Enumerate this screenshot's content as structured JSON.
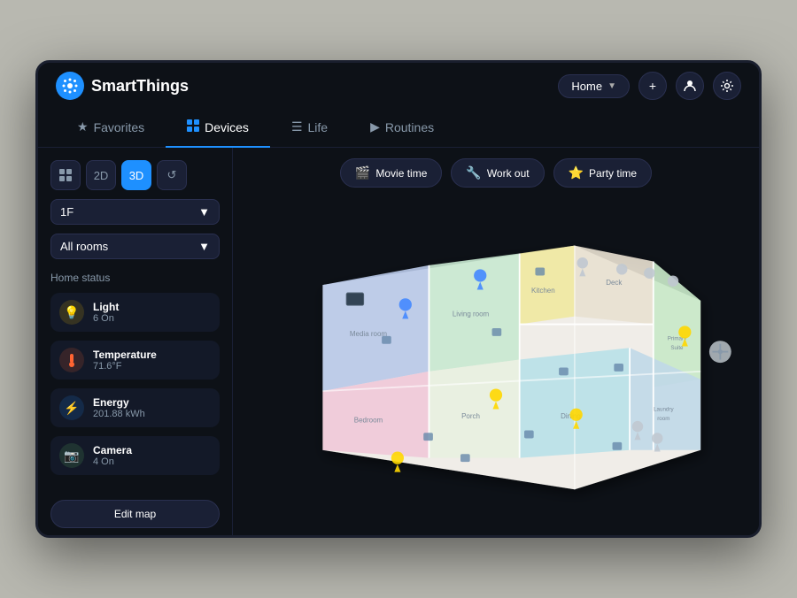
{
  "app": {
    "name": "SmartThings",
    "logo_symbol": "✦"
  },
  "header": {
    "home_selector": "Home",
    "add_label": "+",
    "profile_icon": "person",
    "settings_icon": "gear"
  },
  "nav": {
    "tabs": [
      {
        "id": "favorites",
        "label": "Favorites",
        "icon": "★",
        "active": false
      },
      {
        "id": "devices",
        "label": "Devices",
        "icon": "⊞",
        "active": true
      },
      {
        "id": "life",
        "label": "Life",
        "icon": "☰",
        "active": false
      },
      {
        "id": "routines",
        "label": "Routines",
        "icon": "▶",
        "active": false
      }
    ]
  },
  "sidebar": {
    "view_buttons": [
      {
        "id": "grid",
        "label": "⊞",
        "active": false
      },
      {
        "id": "2d",
        "label": "2D",
        "active": false
      },
      {
        "id": "3d",
        "label": "3D",
        "active": true
      },
      {
        "id": "history",
        "label": "↺",
        "active": false
      }
    ],
    "floor": "1F",
    "room": "All rooms",
    "home_status_title": "Home status",
    "status_items": [
      {
        "id": "light",
        "icon": "💡",
        "name": "Light",
        "value": "6 On",
        "type": "light"
      },
      {
        "id": "temp",
        "icon": "🌡",
        "name": "Temperature",
        "value": "71.6°F",
        "type": "temp"
      },
      {
        "id": "energy",
        "icon": "⚡",
        "name": "Energy",
        "value": "201.88 kWh",
        "type": "energy"
      },
      {
        "id": "camera",
        "icon": "📷",
        "name": "Camera",
        "value": "4 On",
        "type": "camera"
      }
    ],
    "edit_map_label": "Edit map"
  },
  "scenes": [
    {
      "id": "movie",
      "icon": "🎬",
      "label": "Movie time"
    },
    {
      "id": "workout",
      "icon": "🔧",
      "label": "Work out"
    },
    {
      "id": "party",
      "icon": "⭐",
      "label": "Party time"
    }
  ]
}
